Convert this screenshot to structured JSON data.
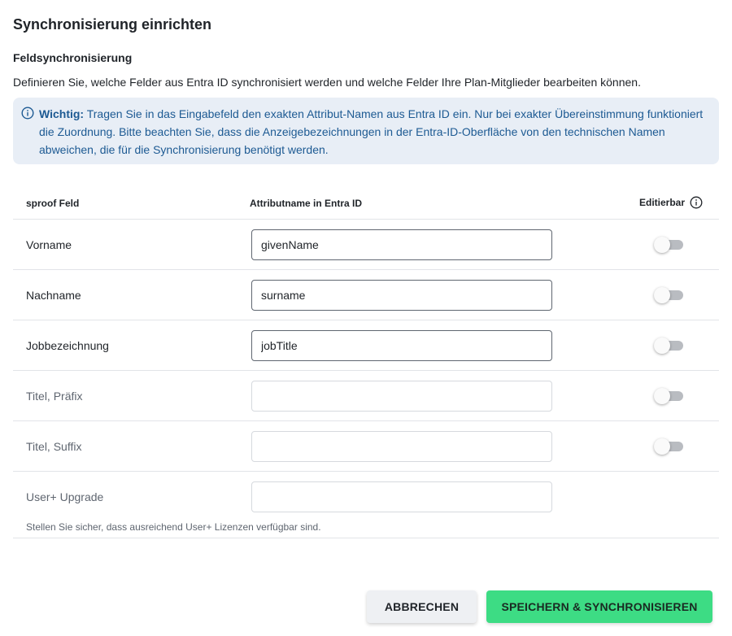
{
  "dialog": {
    "title": "Synchronisierung einrichten"
  },
  "section": {
    "title": "Feldsynchronisierung",
    "description": "Definieren Sie, welche Felder aus Entra ID synchronisiert werden und welche Felder Ihre Plan-Mitglieder bearbeiten können."
  },
  "info": {
    "icon": "info-icon",
    "bold_label": "Wichtig:",
    "text": " Tragen Sie in das Eingabefeld den exakten Attribut-Namen aus Entra ID ein. Nur bei exakter Übereinstimmung funktioniert die Zuordnung. Bitte beachten Sie, dass die Anzeigebezeichnungen in der Entra-ID-Oberfläche von den technischen Namen abweichen, die für die Synchronisierung benötigt werden."
  },
  "table": {
    "headers": {
      "field": "sproof Feld",
      "attribute": "Attributname in Entra ID",
      "editable": "Editierbar"
    },
    "rows": [
      {
        "label": "Vorname",
        "value": "givenName",
        "editable": false
      },
      {
        "label": "Nachname",
        "value": "surname",
        "editable": false
      },
      {
        "label": "Jobbezeichnung",
        "value": "jobTitle",
        "editable": false
      },
      {
        "label": "Titel, Präfix",
        "value": "",
        "editable": false
      },
      {
        "label": "Titel, Suffix",
        "value": "",
        "editable": false
      },
      {
        "label": "User+ Upgrade",
        "value": "",
        "hint": "Stellen Sie sicher, dass ausreichend User+ Lizenzen verfügbar sind."
      }
    ]
  },
  "buttons": {
    "cancel": "ABBRECHEN",
    "save": "SPEICHERN & SYNCHRONISIEREN"
  },
  "colors": {
    "info_bg": "#e8eef6",
    "info_text": "#1d5a93",
    "primary": "#3ddc84"
  }
}
